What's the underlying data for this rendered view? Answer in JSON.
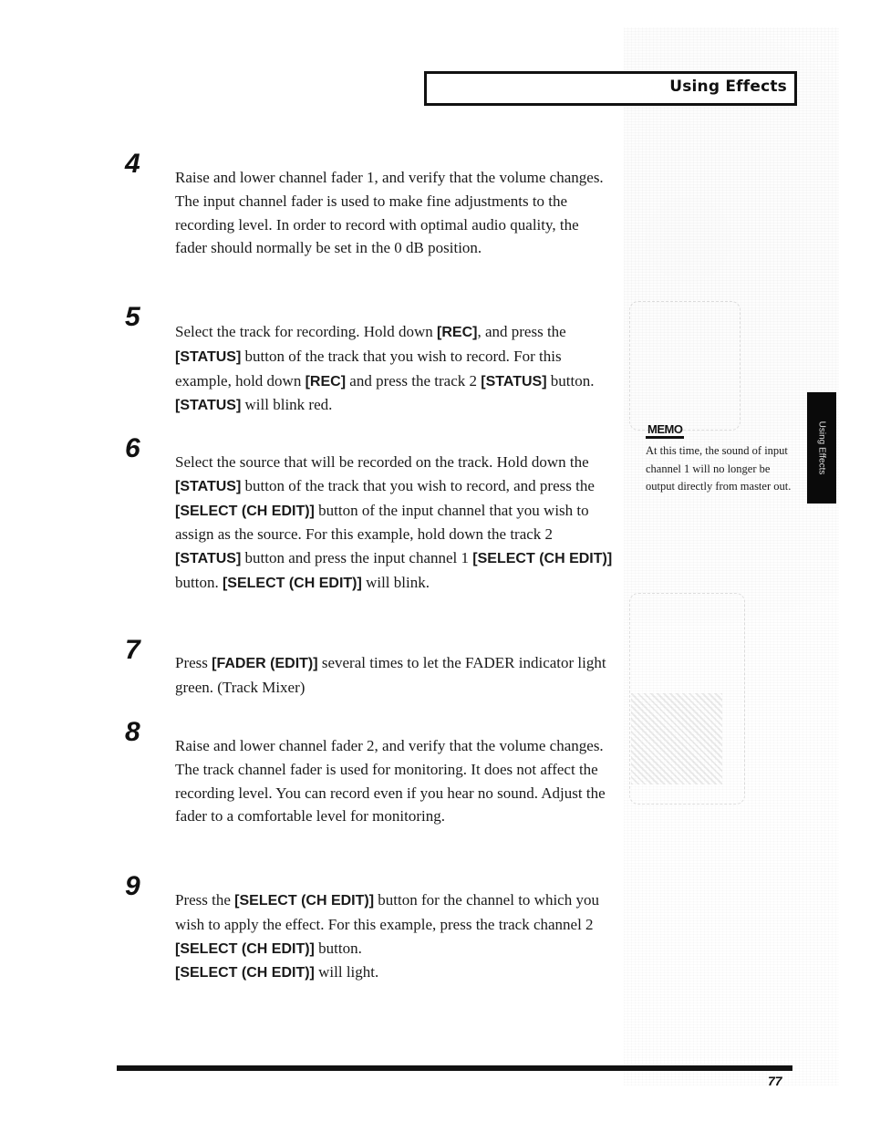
{
  "header": {
    "title": "Using Effects"
  },
  "side_tab": {
    "label": "Using Effects"
  },
  "steps": [
    {
      "number": "4",
      "segments": [
        {
          "t": "Raise and lower channel fader 1, and verify that the volume changes. The input channel fader is used to make fine adjustments to the recording level. In order to record with optimal audio quality, the fader should normally be set in the 0 dB position.",
          "b": false
        }
      ]
    },
    {
      "number": "5",
      "segments": [
        {
          "t": "Select the track for recording. Hold down ",
          "b": false
        },
        {
          "t": "[REC]",
          "b": true
        },
        {
          "t": ", and press the ",
          "b": false
        },
        {
          "t": "[STATUS]",
          "b": true
        },
        {
          "t": " button of the track that you wish to record. For this example, hold down ",
          "b": false
        },
        {
          "t": "[REC]",
          "b": true
        },
        {
          "t": " and press the track 2 ",
          "b": false
        },
        {
          "t": "[STATUS]",
          "b": true
        },
        {
          "t": " button. ",
          "b": false
        },
        {
          "t": "[STATUS]",
          "b": true
        },
        {
          "t": " will blink red.",
          "b": false
        }
      ]
    },
    {
      "number": "6",
      "segments": [
        {
          "t": "Select the source that will be recorded on the track. Hold down the ",
          "b": false
        },
        {
          "t": "[STATUS]",
          "b": true
        },
        {
          "t": " button of the track that you wish to record, and press the ",
          "b": false
        },
        {
          "t": "[SELECT (CH EDIT)]",
          "b": true
        },
        {
          "t": " button of the input channel that you wish to assign as the source. For this example, hold down the track 2 ",
          "b": false
        },
        {
          "t": "[STATUS]",
          "b": true
        },
        {
          "t": " button and press the input channel 1 ",
          "b": false
        },
        {
          "t": "[SELECT (CH EDIT)]",
          "b": true
        },
        {
          "t": " button. ",
          "b": false
        },
        {
          "t": "[SELECT (CH EDIT)]",
          "b": true
        },
        {
          "t": " will blink.",
          "b": false
        }
      ]
    },
    {
      "number": "7",
      "segments": [
        {
          "t": "Press ",
          "b": false
        },
        {
          "t": "[FADER (EDIT)]",
          "b": true
        },
        {
          "t": " several times to let the FADER indicator light green. (Track Mixer)",
          "b": false
        }
      ]
    },
    {
      "number": "8",
      "segments": [
        {
          "t": "Raise and lower channel fader 2, and verify that the volume changes. The track channel fader is used for monitoring. It does not affect the recording level. You can record even if you hear no sound. Adjust the fader to a comfortable level for monitoring.",
          "b": false
        }
      ]
    },
    {
      "number": "9",
      "segments": [
        {
          "t": "Press the ",
          "b": false
        },
        {
          "t": "[SELECT (CH EDIT)]",
          "b": true
        },
        {
          "t": " button for the channel to which you wish to apply the effect. For this example, press the track channel 2 ",
          "b": false
        },
        {
          "t": "[SELECT (CH EDIT)]",
          "b": true
        },
        {
          "t": " button.",
          "b": false
        },
        {
          "br": true
        },
        {
          "t": "[SELECT (CH EDIT)]",
          "b": true
        },
        {
          "t": " will light.",
          "b": false
        }
      ]
    }
  ],
  "memo": {
    "icon_label": "MEMO",
    "text": "At this time, the sound of input channel 1 will no longer be output directly from master out."
  },
  "footer": {
    "page_number": "77"
  }
}
